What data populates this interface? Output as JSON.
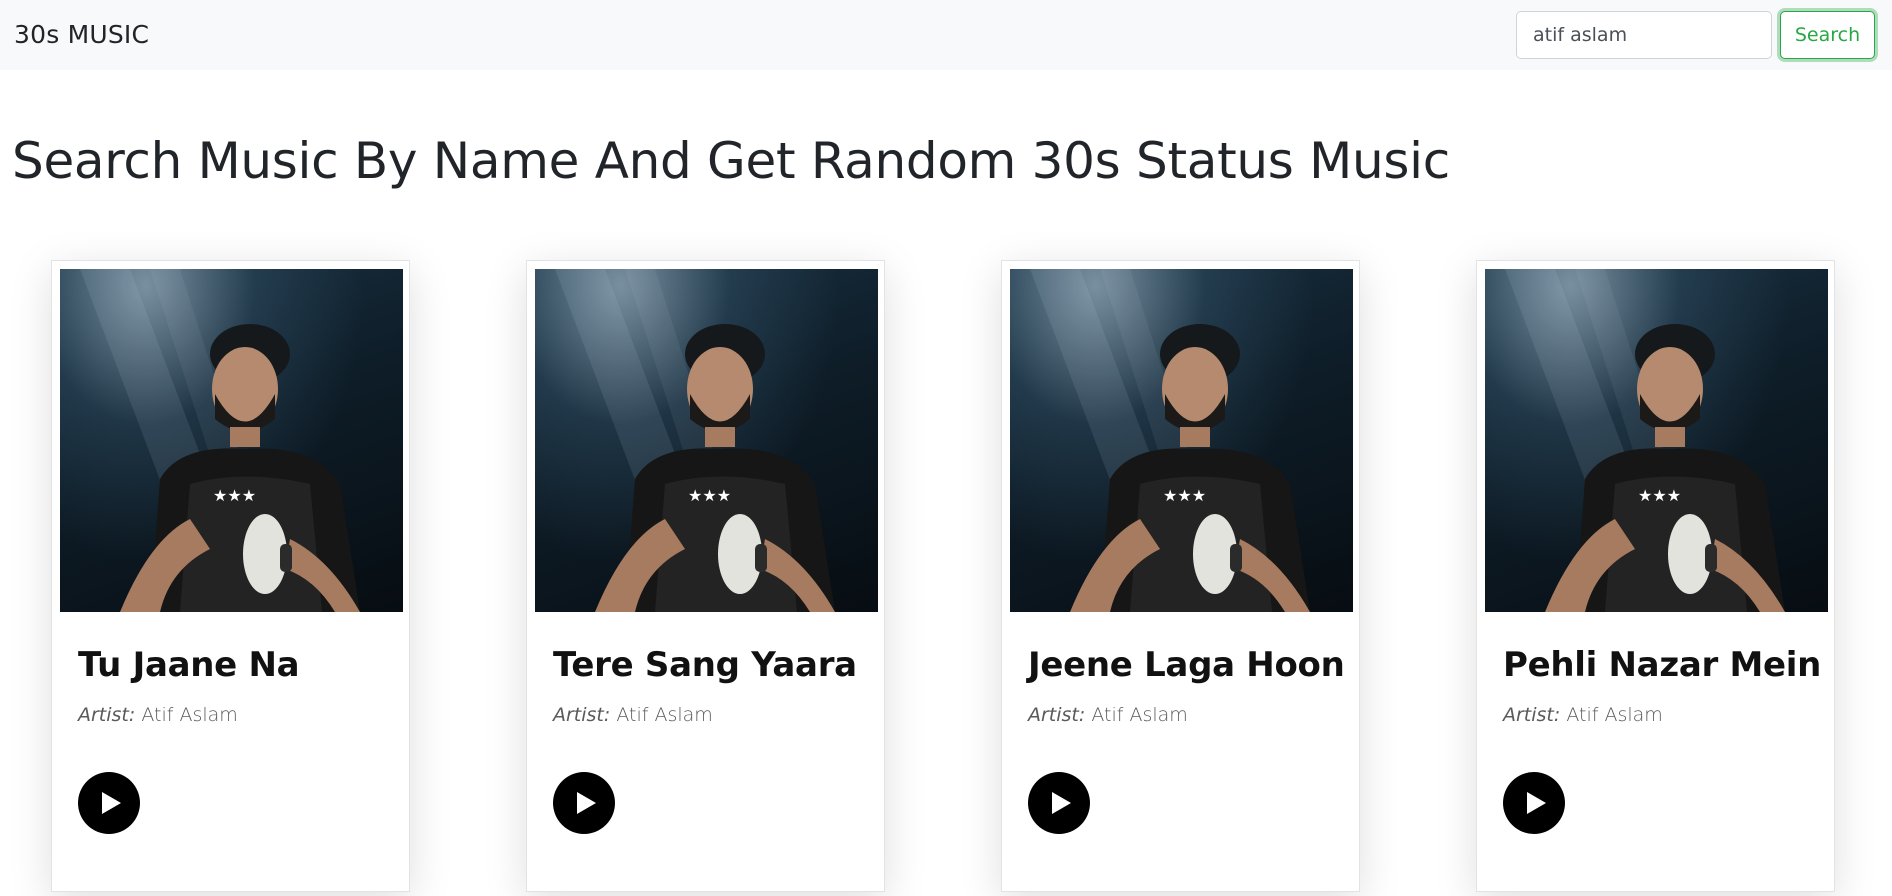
{
  "navbar": {
    "brand": "30s MUSIC",
    "search_value": "atif aslam",
    "search_button": "Search"
  },
  "main": {
    "heading": "Search Music By Name And Get Random 30s Status Music",
    "artist_label": "Artist:",
    "cards": [
      {
        "title": "Tu Jaane Na",
        "artist": "Atif Aslam"
      },
      {
        "title": "Tere Sang Yaara",
        "artist": "Atif Aslam"
      },
      {
        "title": "Jeene Laga Hoon",
        "artist": "Atif Aslam"
      },
      {
        "title": "Pehli Nazar Mein",
        "artist": "Atif Aslam"
      }
    ]
  },
  "colors": {
    "navbar_bg": "#f8f9fa",
    "search_accent": "#28a745",
    "play_button": "#000000"
  },
  "icons": {
    "play": "play-icon"
  }
}
